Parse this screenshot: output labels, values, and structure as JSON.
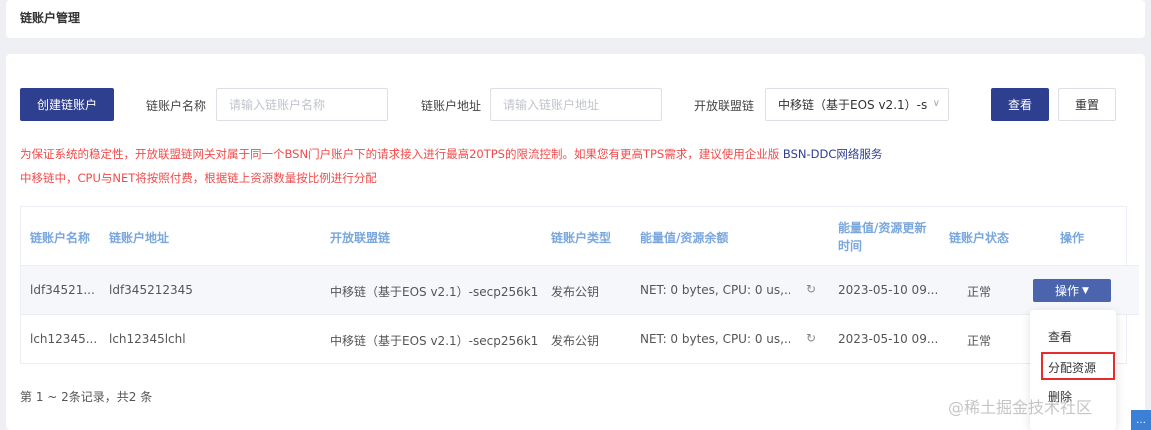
{
  "header": {
    "title": "链账户管理"
  },
  "toolbar": {
    "create_label": "创建链账户",
    "name_label": "链账户名称",
    "name_placeholder": "请输入链账户名称",
    "address_label": "链账户地址",
    "address_placeholder": "请输入链账户地址",
    "chain_label": "开放联盟链",
    "chain_value": "中移链（基于EOS v2.1）-s",
    "search_label": "查看",
    "reset_label": "重置"
  },
  "notice": {
    "line1": "为保证系统的稳定性，开放联盟链网关对属于同一个BSN门户账户下的请求接入进行最高20TPS的限流控制。如果您有更高TPS需求，建议使用企业版 ",
    "line1_link": "BSN-DDC网络服务",
    "line2": "中移链中，CPU与NET将按照付费，根据链上资源数量按比例进行分配"
  },
  "table": {
    "headers": {
      "name": "链账户名称",
      "address": "链账户地址",
      "chain": "开放联盟链",
      "type": "链账户类型",
      "energy": "能量值/资源余额",
      "updated_1": "能量值/资源更新",
      "updated_2": "时间",
      "status": "链账户状态",
      "actions": "操作"
    },
    "rows": [
      {
        "name": "ldf34521...",
        "address": "ldf345212345",
        "chain": "中移链（基于EOS v2.1）-secp256k1",
        "type": "发布公钥",
        "energy": "NET: 0 bytes, CPU: 0 us,...",
        "updated": "2023-05-10 09...",
        "status": "正常",
        "action": "操作"
      },
      {
        "name": "lch12345...",
        "address": "lch12345lchl",
        "chain": "中移链（基于EOS v2.1）-secp256k1",
        "type": "发布公钥",
        "energy": "NET: 0 bytes, CPU: 0 us,...",
        "updated": "2023-05-10 09...",
        "status": "正常"
      }
    ]
  },
  "dropdown": {
    "view": "查看",
    "allocate": "分配资源",
    "delete": "删除"
  },
  "pager": {
    "summary": "第 1 ~ 2条记录，共2 条"
  },
  "watermark": "@稀土掘金技术社区",
  "icons": {
    "refresh": "refresh-icon",
    "caret": "caret-down-icon",
    "chevron": "chevron-down-icon",
    "chat": "chat-icon"
  }
}
